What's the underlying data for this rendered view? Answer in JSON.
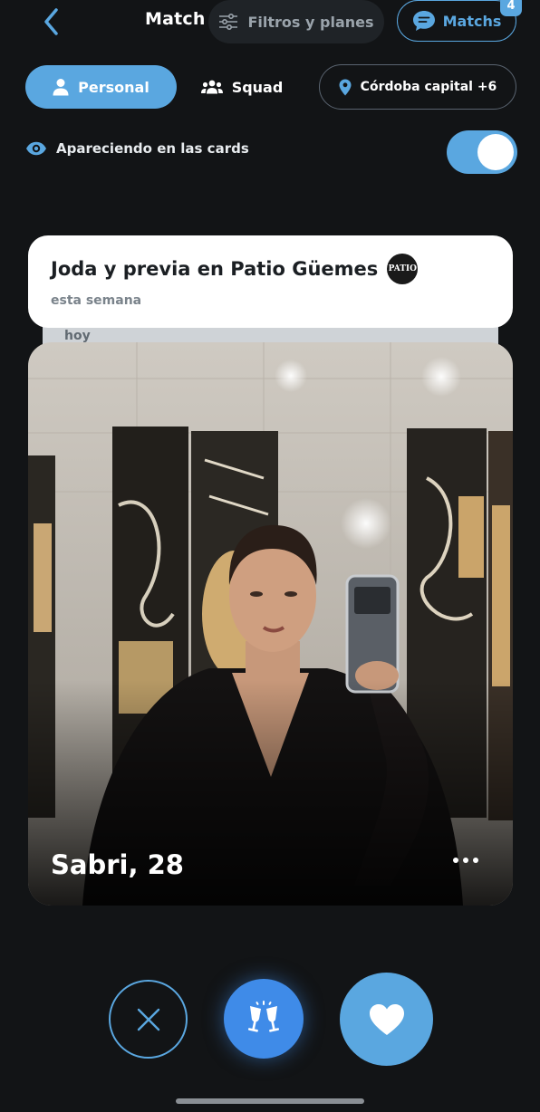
{
  "header": {
    "title": "Match",
    "filters_label": "Filtros y planes",
    "matchs_label": "Matchs",
    "matchs_badge": "4"
  },
  "mode": {
    "personal_label": "Personal",
    "squad_label": "Squad",
    "location_label": "Córdoba capital +6"
  },
  "visibility": {
    "label": "Apareciendo en las cards",
    "enabled": true
  },
  "event": {
    "title": "Joda y previa en Patio Güemes",
    "when": "esta semana",
    "logo_text": "PATIO",
    "next_card_when": "hoy"
  },
  "profile": {
    "name": "Sabri, 28"
  },
  "colors": {
    "background": "#121416",
    "accent": "#5aa7e0",
    "cheers": "#3f8be8"
  },
  "icons": {
    "back": "chevron-left-icon",
    "filters": "sliders-icon",
    "matchs": "chat-bubble-icon",
    "personal": "person-icon",
    "squad": "group-icon",
    "location": "location-pin-icon",
    "visibility": "eye-icon",
    "pass": "close-icon",
    "cheers": "cheers-icon",
    "like": "heart-icon",
    "more": "more-dots-icon"
  }
}
